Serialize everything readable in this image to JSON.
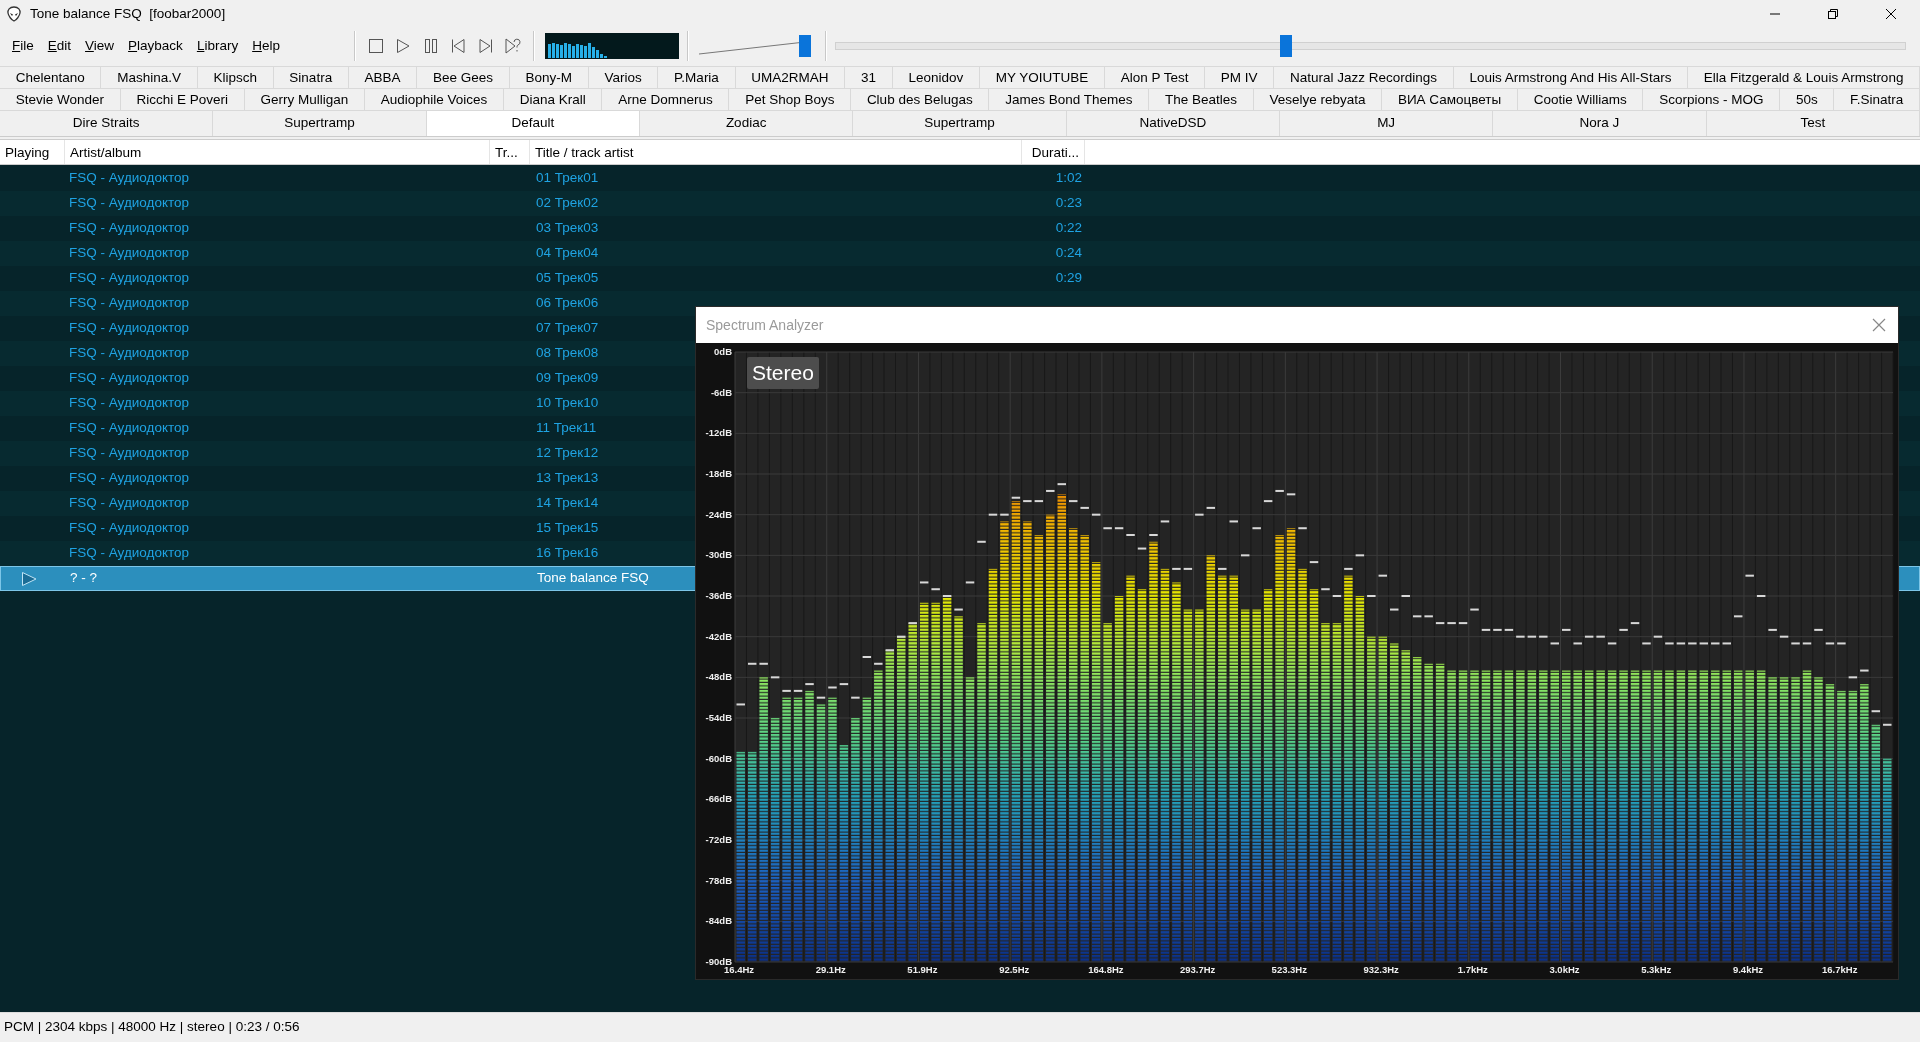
{
  "window": {
    "title": "Tone balance FSQ  [foobar2000]"
  },
  "menu": [
    "File",
    "Edit",
    "View",
    "Playback",
    "Library",
    "Help"
  ],
  "volume": {
    "level": 0.95
  },
  "seek": {
    "level": 0.42
  },
  "tab_rows": [
    [
      {
        "label": "Chelentano",
        "selected": false
      },
      {
        "label": "Mashina.V",
        "selected": false
      },
      {
        "label": "Klipsch",
        "selected": false
      },
      {
        "label": "Sinatra",
        "selected": false
      },
      {
        "label": "ABBA",
        "selected": false
      },
      {
        "label": "Bee Gees",
        "selected": false
      },
      {
        "label": "Bony-M",
        "selected": false
      },
      {
        "label": "Varios",
        "selected": false
      },
      {
        "label": "P.Maria",
        "selected": false
      },
      {
        "label": "UMA2RMAH",
        "selected": false
      },
      {
        "label": "31",
        "selected": false
      },
      {
        "label": "Leonidov",
        "selected": false
      },
      {
        "label": "MY YOIUTUBE",
        "selected": false
      },
      {
        "label": "Alon P Test",
        "selected": false
      },
      {
        "label": "PM IV",
        "selected": false
      },
      {
        "label": "Natural Jazz Recordings",
        "selected": false
      },
      {
        "label": "Louis Armstrong And His All-Stars",
        "selected": false
      },
      {
        "label": "Ella Fitzgerald & Louis Armstrong",
        "selected": false
      }
    ],
    [
      {
        "label": "Stevie Wonder",
        "selected": false
      },
      {
        "label": "Ricchi E Poveri",
        "selected": false
      },
      {
        "label": "Gerry Mulligan",
        "selected": false
      },
      {
        "label": "Audiophile Voices",
        "selected": false
      },
      {
        "label": "Diana Krall",
        "selected": false
      },
      {
        "label": "Arne Domnerus",
        "selected": false
      },
      {
        "label": "Pet Shop Boys",
        "selected": false
      },
      {
        "label": "Club des Belugas",
        "selected": false
      },
      {
        "label": "James Bond Themes",
        "selected": false
      },
      {
        "label": "The Beatles",
        "selected": false
      },
      {
        "label": "Veselye rebyata",
        "selected": false
      },
      {
        "label": "ВИА Самоцветы",
        "selected": false
      },
      {
        "label": "Cootie Williams",
        "selected": false
      },
      {
        "label": "Scorpions - MOG",
        "selected": false
      },
      {
        "label": "50s",
        "selected": false
      },
      {
        "label": "F.Sinatra",
        "selected": false
      }
    ],
    [
      {
        "label": "Dire Straits",
        "selected": false
      },
      {
        "label": "Supertramp",
        "selected": false
      },
      {
        "label": "Default",
        "selected": true
      },
      {
        "label": "Zodiac",
        "selected": false
      },
      {
        "label": "Supertramp",
        "selected": false
      },
      {
        "label": "NativeDSD",
        "selected": false
      },
      {
        "label": "MJ",
        "selected": false
      },
      {
        "label": "Nora J",
        "selected": false
      },
      {
        "label": "Test",
        "selected": false
      }
    ]
  ],
  "playlist": {
    "columns": [
      "Playing",
      "Artist/album",
      "Tr...",
      "Title / track artist",
      "Durati..."
    ],
    "rows": [
      {
        "artist_album": "FSQ - Аудиодоктор",
        "title": "01 Трек01",
        "duration": "1:02",
        "playing": false,
        "selected": false
      },
      {
        "artist_album": "FSQ - Аудиодоктор",
        "title": "02 Трек02",
        "duration": "0:23",
        "playing": false,
        "selected": false
      },
      {
        "artist_album": "FSQ - Аудиодоктор",
        "title": "03 Трек03",
        "duration": "0:22",
        "playing": false,
        "selected": false
      },
      {
        "artist_album": "FSQ - Аудиодоктор",
        "title": "04 Трек04",
        "duration": "0:24",
        "playing": false,
        "selected": false
      },
      {
        "artist_album": "FSQ - Аудиодоктор",
        "title": "05 Трек05",
        "duration": "0:29",
        "playing": false,
        "selected": false
      },
      {
        "artist_album": "FSQ - Аудиодоктор",
        "title": "06 Трек06",
        "playing": false,
        "selected": false
      },
      {
        "artist_album": "FSQ - Аудиодоктор",
        "title": "07 Трек07",
        "playing": false,
        "selected": false
      },
      {
        "artist_album": "FSQ - Аудиодоктор",
        "title": "08 Трек08",
        "playing": false,
        "selected": false
      },
      {
        "artist_album": "FSQ - Аудиодоктор",
        "title": "09 Трек09",
        "playing": false,
        "selected": false
      },
      {
        "artist_album": "FSQ - Аудиодоктор",
        "title": "10 Трек10",
        "playing": false,
        "selected": false
      },
      {
        "artist_album": "FSQ - Аудиодоктор",
        "title": "11 Трек11",
        "playing": false,
        "selected": false
      },
      {
        "artist_album": "FSQ - Аудиодоктор",
        "title": "12 Трек12",
        "playing": false,
        "selected": false
      },
      {
        "artist_album": "FSQ - Аудиодоктор",
        "title": "13 Трек13",
        "playing": false,
        "selected": false
      },
      {
        "artist_album": "FSQ - Аудиодоктор",
        "title": "14 Трек14",
        "playing": false,
        "selected": false
      },
      {
        "artist_album": "FSQ - Аудиодоктор",
        "title": "15 Трек15",
        "playing": false,
        "selected": false
      },
      {
        "artist_album": "FSQ - Аудиодоктор",
        "title": "16 Трек16",
        "playing": false,
        "selected": false
      },
      {
        "artist_album": "? - ?",
        "title": "Tone balance FSQ",
        "playing": true,
        "selected": true
      }
    ]
  },
  "spectrum_analyzer": {
    "title": "Spectrum Analyzer",
    "channel_label": "Stereo",
    "y_axis_labels": [
      "0dB",
      "-6dB",
      "-12dB",
      "-18dB",
      "-24dB",
      "-30dB",
      "-36dB",
      "-42dB",
      "-48dB",
      "-54dB",
      "-60dB",
      "-66dB",
      "-72dB",
      "-78dB",
      "-84dB",
      "-90dB"
    ],
    "x_axis_labels": [
      "16.4Hz",
      "29.1Hz",
      "51.9Hz",
      "92.5Hz",
      "164.8Hz",
      "293.7Hz",
      "523.3Hz",
      "932.3Hz",
      "1.7kHz",
      "3.0kHz",
      "5.3kHz",
      "9.4kHz",
      "16.7kHz"
    ]
  },
  "status_bar": "PCM | 2304 kbps | 48000 Hz | stereo | 0:23 / 0:56"
}
